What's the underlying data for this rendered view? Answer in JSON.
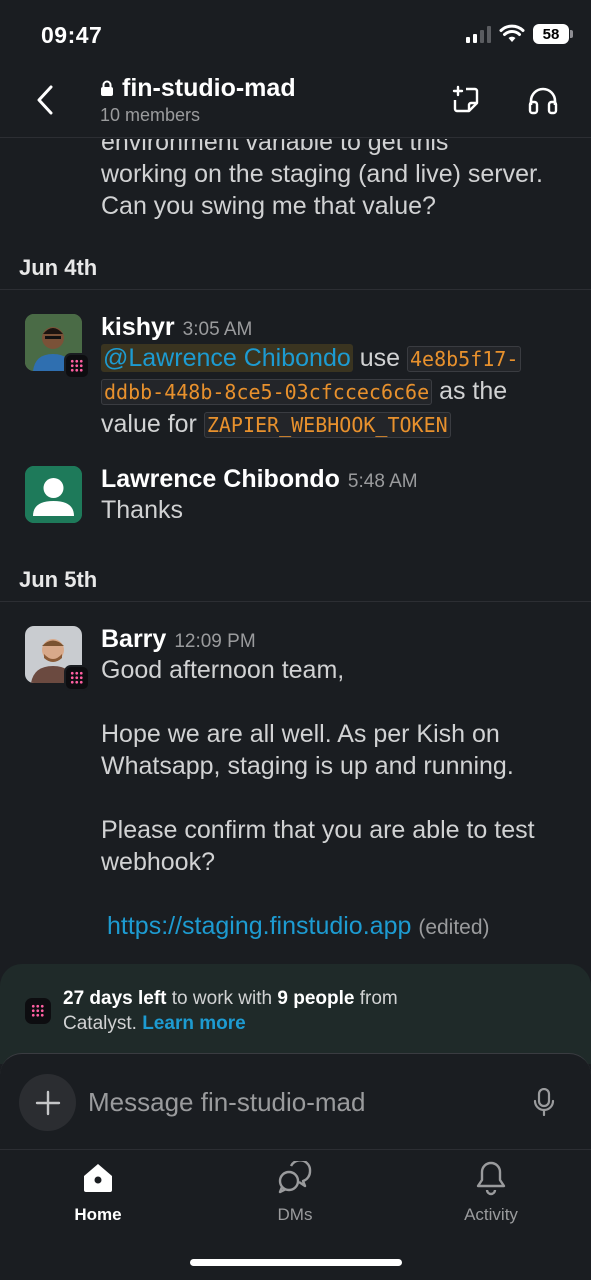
{
  "status_bar": {
    "time": "09:47",
    "battery": "58"
  },
  "header": {
    "channel": "fin-studio-mad",
    "members": "10 members"
  },
  "feed": {
    "partial_message": {
      "line1": "environment variable to get this",
      "line2": "working on the staging (and live) server.",
      "line3": "Can you swing me that value?"
    },
    "day1": "Jun 4th",
    "msg1": {
      "author": "kishyr",
      "time": "3:05 AM",
      "mention": "@Lawrence Chibondo",
      "text_use": "use",
      "token_part1": "4e8b5f17-",
      "token_part2": "ddbb-448b-8ce5-03cfccec6c6e",
      "text_as": "as the",
      "text_value_for": "value for",
      "env_name": "ZAPIER_WEBHOOK_TOKEN"
    },
    "msg2": {
      "author": "Lawrence Chibondo",
      "time": "5:48 AM",
      "text": "Thanks"
    },
    "day2": "Jun 5th",
    "msg3": {
      "author": "Barry",
      "time": "12:09 PM",
      "p1": "Good afternoon team,",
      "p2": "Hope we are all well. As per Kish on Whatsapp, staging is up and running.",
      "p3": "Please confirm that you are able to test webhook?",
      "link": "https://staging.finstudio.app",
      "edited": "(edited)"
    }
  },
  "trial": {
    "days": "27 days left",
    "mid": "to work with",
    "people": "9 people",
    "from": "from",
    "org": "Catalyst.",
    "learn_more": "Learn more"
  },
  "composer": {
    "placeholder": "Message fin-studio-mad"
  },
  "tabs": {
    "home": "Home",
    "dms": "DMs",
    "activity": "Activity"
  },
  "colors": {
    "background": "#1a1d21",
    "link": "#1d9bd1",
    "code": "#e8912d",
    "trial_bg": "#1f2a29",
    "badge_dot": "#ff5fa2"
  }
}
